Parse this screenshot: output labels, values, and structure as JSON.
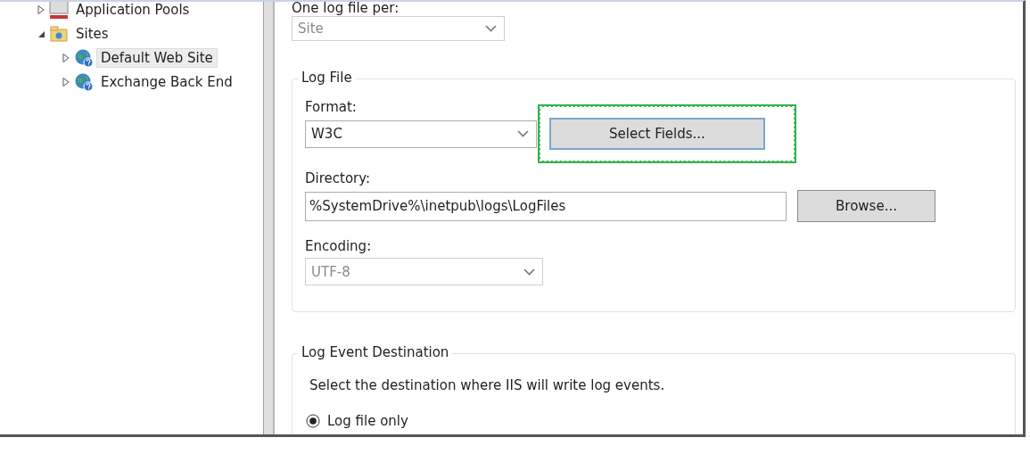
{
  "tree": [
    {
      "label": "Application Pools",
      "expanded": false,
      "selected": false,
      "kind": "pool"
    },
    {
      "label": "Sites",
      "expanded": true,
      "selected": false,
      "kind": "folder",
      "children": [
        {
          "label": "Default Web Site",
          "expanded": false,
          "selected": true,
          "kind": "site"
        },
        {
          "label": "Exchange Back End",
          "expanded": false,
          "selected": false,
          "kind": "site"
        }
      ]
    }
  ],
  "log_per": {
    "label": "One log file per:",
    "value": "Site",
    "disabled": true
  },
  "log_file": {
    "title": "Log File",
    "format": {
      "label": "Format:",
      "value": "W3C",
      "disabled": false
    },
    "select_fields": {
      "label": "Select Fields...",
      "focused": true
    },
    "directory": {
      "label": "Directory:",
      "value": "%SystemDrive%\\inetpub\\logs\\LogFiles"
    },
    "browse": {
      "label": "Browse..."
    },
    "encoding": {
      "label": "Encoding:",
      "value": "UTF-8",
      "disabled": true
    }
  },
  "log_event": {
    "title": "Log Event Destination",
    "description": "Select the destination where IIS will write log events.",
    "options": [
      {
        "label": "Log file only",
        "selected": true
      }
    ]
  }
}
